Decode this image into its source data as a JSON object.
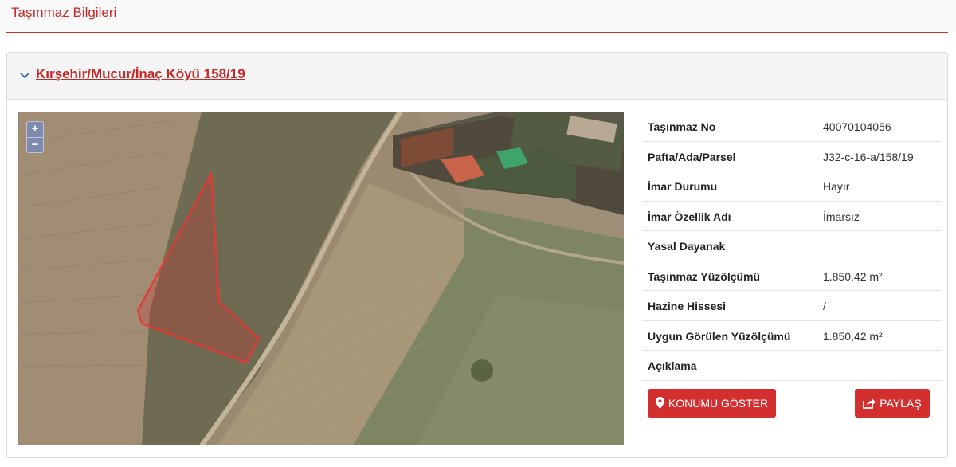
{
  "page": {
    "title": "Taşınmaz Bilgileri"
  },
  "panel": {
    "title": "Kırşehir/Mucur/İnaç Köyü 158/19"
  },
  "map": {
    "zoom_in": "+",
    "zoom_out": "−"
  },
  "info": {
    "rows": [
      {
        "label": "Taşınmaz No",
        "value": "40070104056"
      },
      {
        "label": "Pafta/Ada/Parsel",
        "value": "J32-c-16-a/158/19"
      },
      {
        "label": "İmar Durumu",
        "value": "Hayır"
      },
      {
        "label": "İmar Özellik Adı",
        "value": "İmarsız"
      },
      {
        "label": "Yasal Dayanak",
        "value": ""
      },
      {
        "label": "Taşınmaz Yüzölçümü",
        "value": "1.850,42 m²"
      },
      {
        "label": "Hazine Hissesi",
        "value": "/"
      },
      {
        "label": "Uygun Görülen Yüzölçümü",
        "value": "1.850,42 m²"
      },
      {
        "label": "Açıklama",
        "value": ""
      }
    ]
  },
  "buttons": {
    "show_location": "KONUMU GÖSTER",
    "share": "PAYLAŞ"
  },
  "colors": {
    "accent": "#d32f2f",
    "title_red": "#c62828",
    "parcel_outline": "#e53935"
  }
}
